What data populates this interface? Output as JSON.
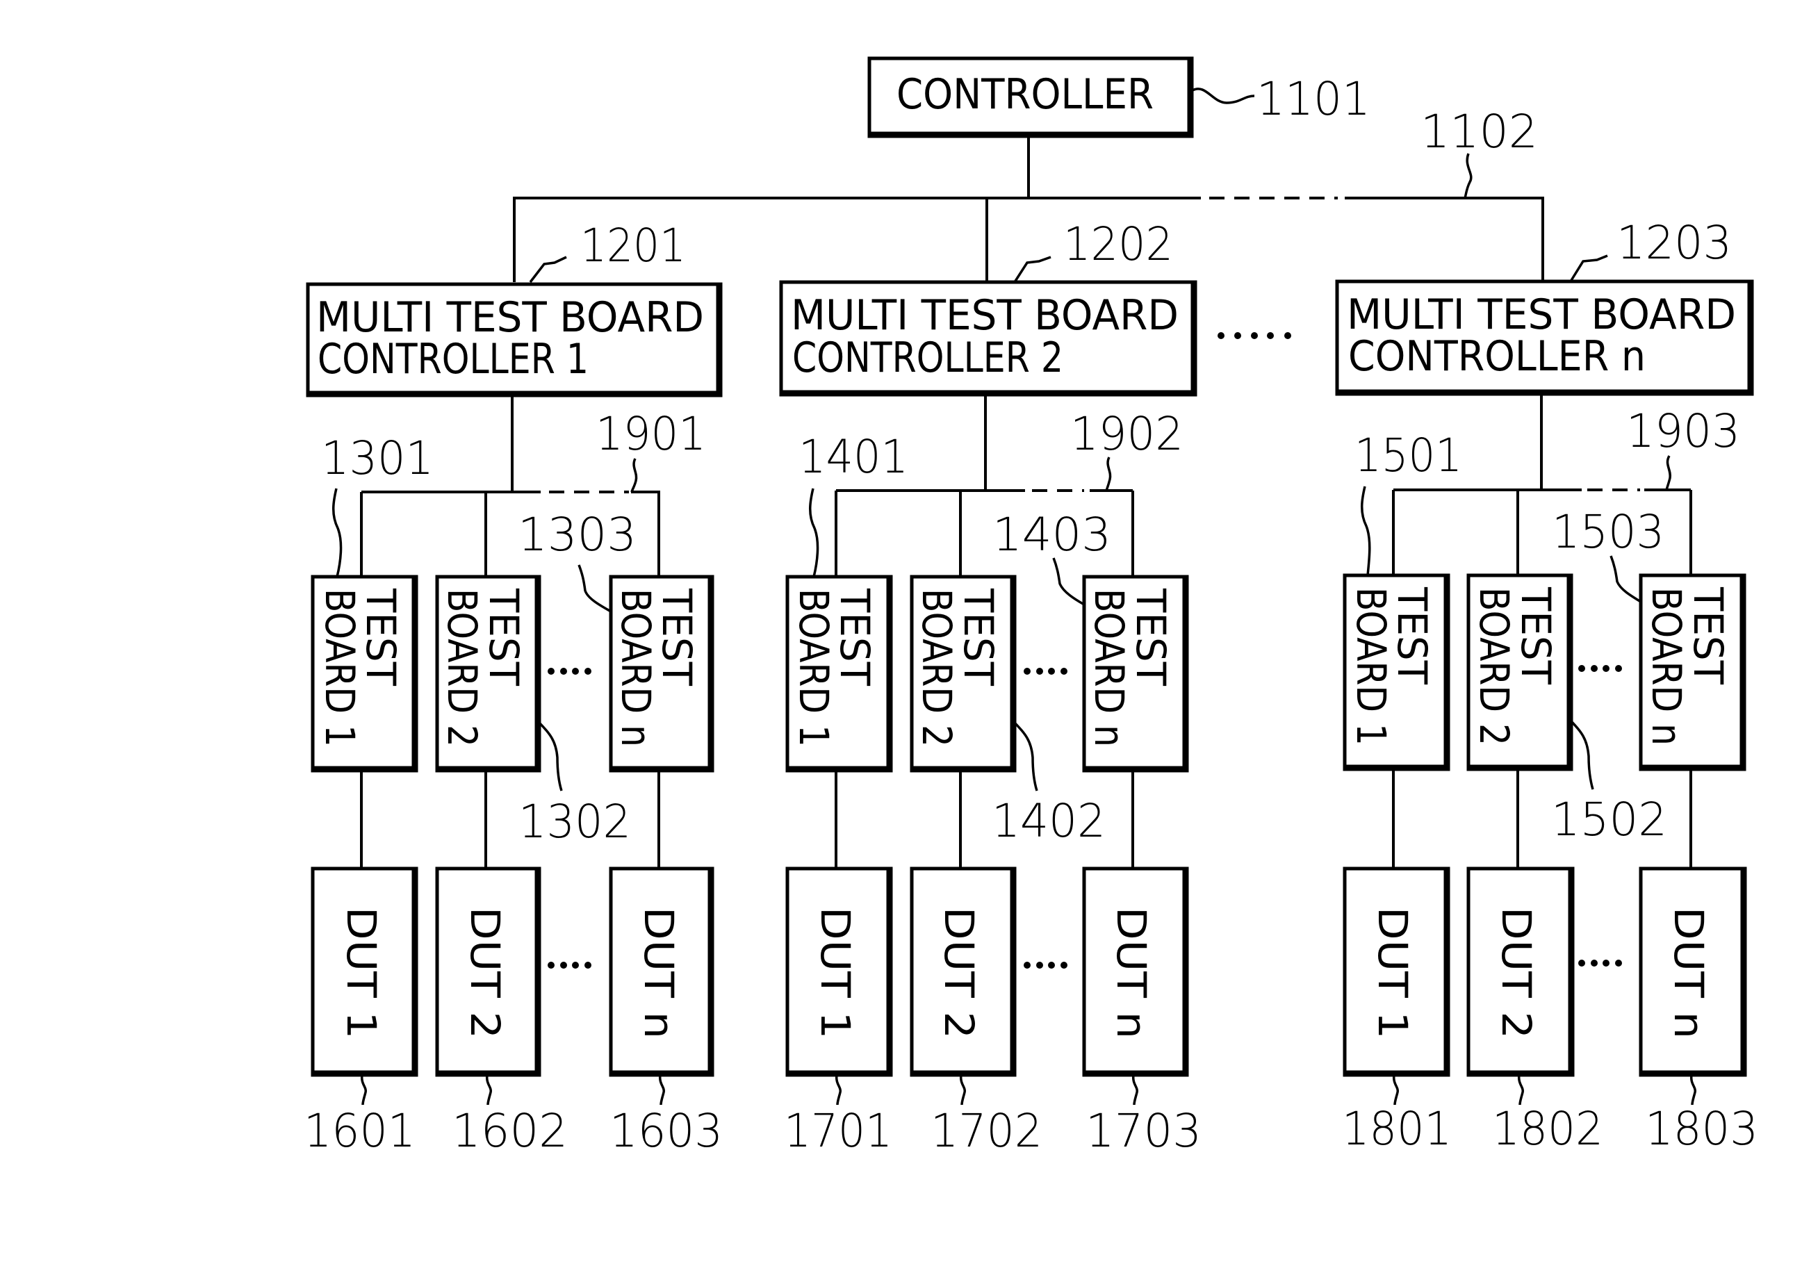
{
  "figure": {
    "controller": {
      "label": "CONTROLLER",
      "ref": "1101"
    },
    "main_bus_ref": "1102",
    "groups": [
      {
        "mtbc": {
          "line1": "MULTI TEST BOARD",
          "line2": "CONTROLLER 1",
          "ref": "1201"
        },
        "bus_ref": "1901",
        "test_boards": [
          {
            "line1": "TEST",
            "line2": "BOARD 1",
            "ref": "1301"
          },
          {
            "line1": "TEST",
            "line2": "BOARD 2",
            "ref": "1302"
          },
          {
            "line1": "TEST",
            "line2": "BOARD n",
            "ref": "1303"
          }
        ],
        "duts": [
          {
            "label": "DUT 1",
            "ref": "1601"
          },
          {
            "label": "DUT 2",
            "ref": "1602"
          },
          {
            "label": "DUT n",
            "ref": "1603"
          }
        ]
      },
      {
        "mtbc": {
          "line1": "MULTI TEST BOARD",
          "line2": "CONTROLLER 2",
          "ref": "1202"
        },
        "bus_ref": "1902",
        "test_boards": [
          {
            "line1": "TEST",
            "line2": "BOARD 1",
            "ref": "1401"
          },
          {
            "line1": "TEST",
            "line2": "BOARD 2",
            "ref": "1402"
          },
          {
            "line1": "TEST",
            "line2": "BOARD n",
            "ref": "1403"
          }
        ],
        "duts": [
          {
            "label": "DUT 1",
            "ref": "1701"
          },
          {
            "label": "DUT 2",
            "ref": "1702"
          },
          {
            "label": "DUT n",
            "ref": "1703"
          }
        ]
      },
      {
        "mtbc": {
          "line1": "MULTI TEST BOARD",
          "line2": "CONTROLLER n",
          "ref": "1203"
        },
        "bus_ref": "1903",
        "test_boards": [
          {
            "line1": "TEST",
            "line2": "BOARD 1",
            "ref": "1501"
          },
          {
            "line1": "TEST",
            "line2": "BOARD 2",
            "ref": "1502"
          },
          {
            "line1": "TEST",
            "line2": "BOARD n",
            "ref": "1503"
          }
        ],
        "duts": [
          {
            "label": "DUT 1",
            "ref": "1801"
          },
          {
            "label": "DUT 2",
            "ref": "1802"
          },
          {
            "label": "DUT n",
            "ref": "1803"
          }
        ]
      }
    ],
    "ellipsis": "....."
  }
}
